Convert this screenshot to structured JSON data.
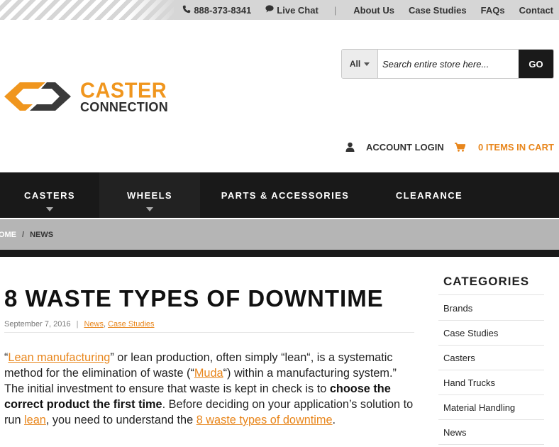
{
  "topbar": {
    "phone": "888-373-8341",
    "live_chat": "Live Chat",
    "separator": "|",
    "links": [
      "About Us",
      "Case Studies",
      "FAQs",
      "Contact"
    ]
  },
  "logo": {
    "line1": "CASTER",
    "line2": "CONNECTION"
  },
  "search": {
    "scope": "All",
    "placeholder": "Search entire store here...",
    "button": "GO"
  },
  "account": {
    "login": "ACCOUNT LOGIN",
    "cart": "0 ITEMS IN CART"
  },
  "nav": {
    "items": [
      "CASTERS",
      "WHEELS",
      "PARTS & ACCESSORIES",
      "CLEARANCE"
    ]
  },
  "breadcrumb": {
    "home": "HOME",
    "slash": "/",
    "current": "NEWS"
  },
  "article": {
    "title": "8 WASTE TYPES OF DOWNTIME",
    "date": "September 7, 2016",
    "meta_sep": "|",
    "categories": [
      "News",
      "Case Studies"
    ],
    "comma": ",",
    "p": {
      "t1": "“",
      "link1": "Lean manufacturing",
      "t2": "” or lean production, often simply “lean“, is a systematic method for the elimination of waste (“",
      "link2": "Muda",
      "t3": "“) within a manufacturing system.” The initial investment to ensure that waste is kept in check is to ",
      "bold": "choose the correct product the first time",
      "t4": ". Before deciding on your application’s solution to run ",
      "link3": "lean",
      "t5": ", you need to understand the ",
      "link4": "8 waste types of downtime",
      "t6": "."
    }
  },
  "sidebar": {
    "heading": "CATEGORIES",
    "items": [
      "Brands",
      "Case Studies",
      "Casters",
      "Hand Trucks",
      "Material Handling",
      "News"
    ]
  },
  "colors": {
    "accent": "#e8861c",
    "logo_orange": "#f0961e",
    "nav_bg": "#191919",
    "breadcrumb_bg": "#b5b5b5"
  }
}
